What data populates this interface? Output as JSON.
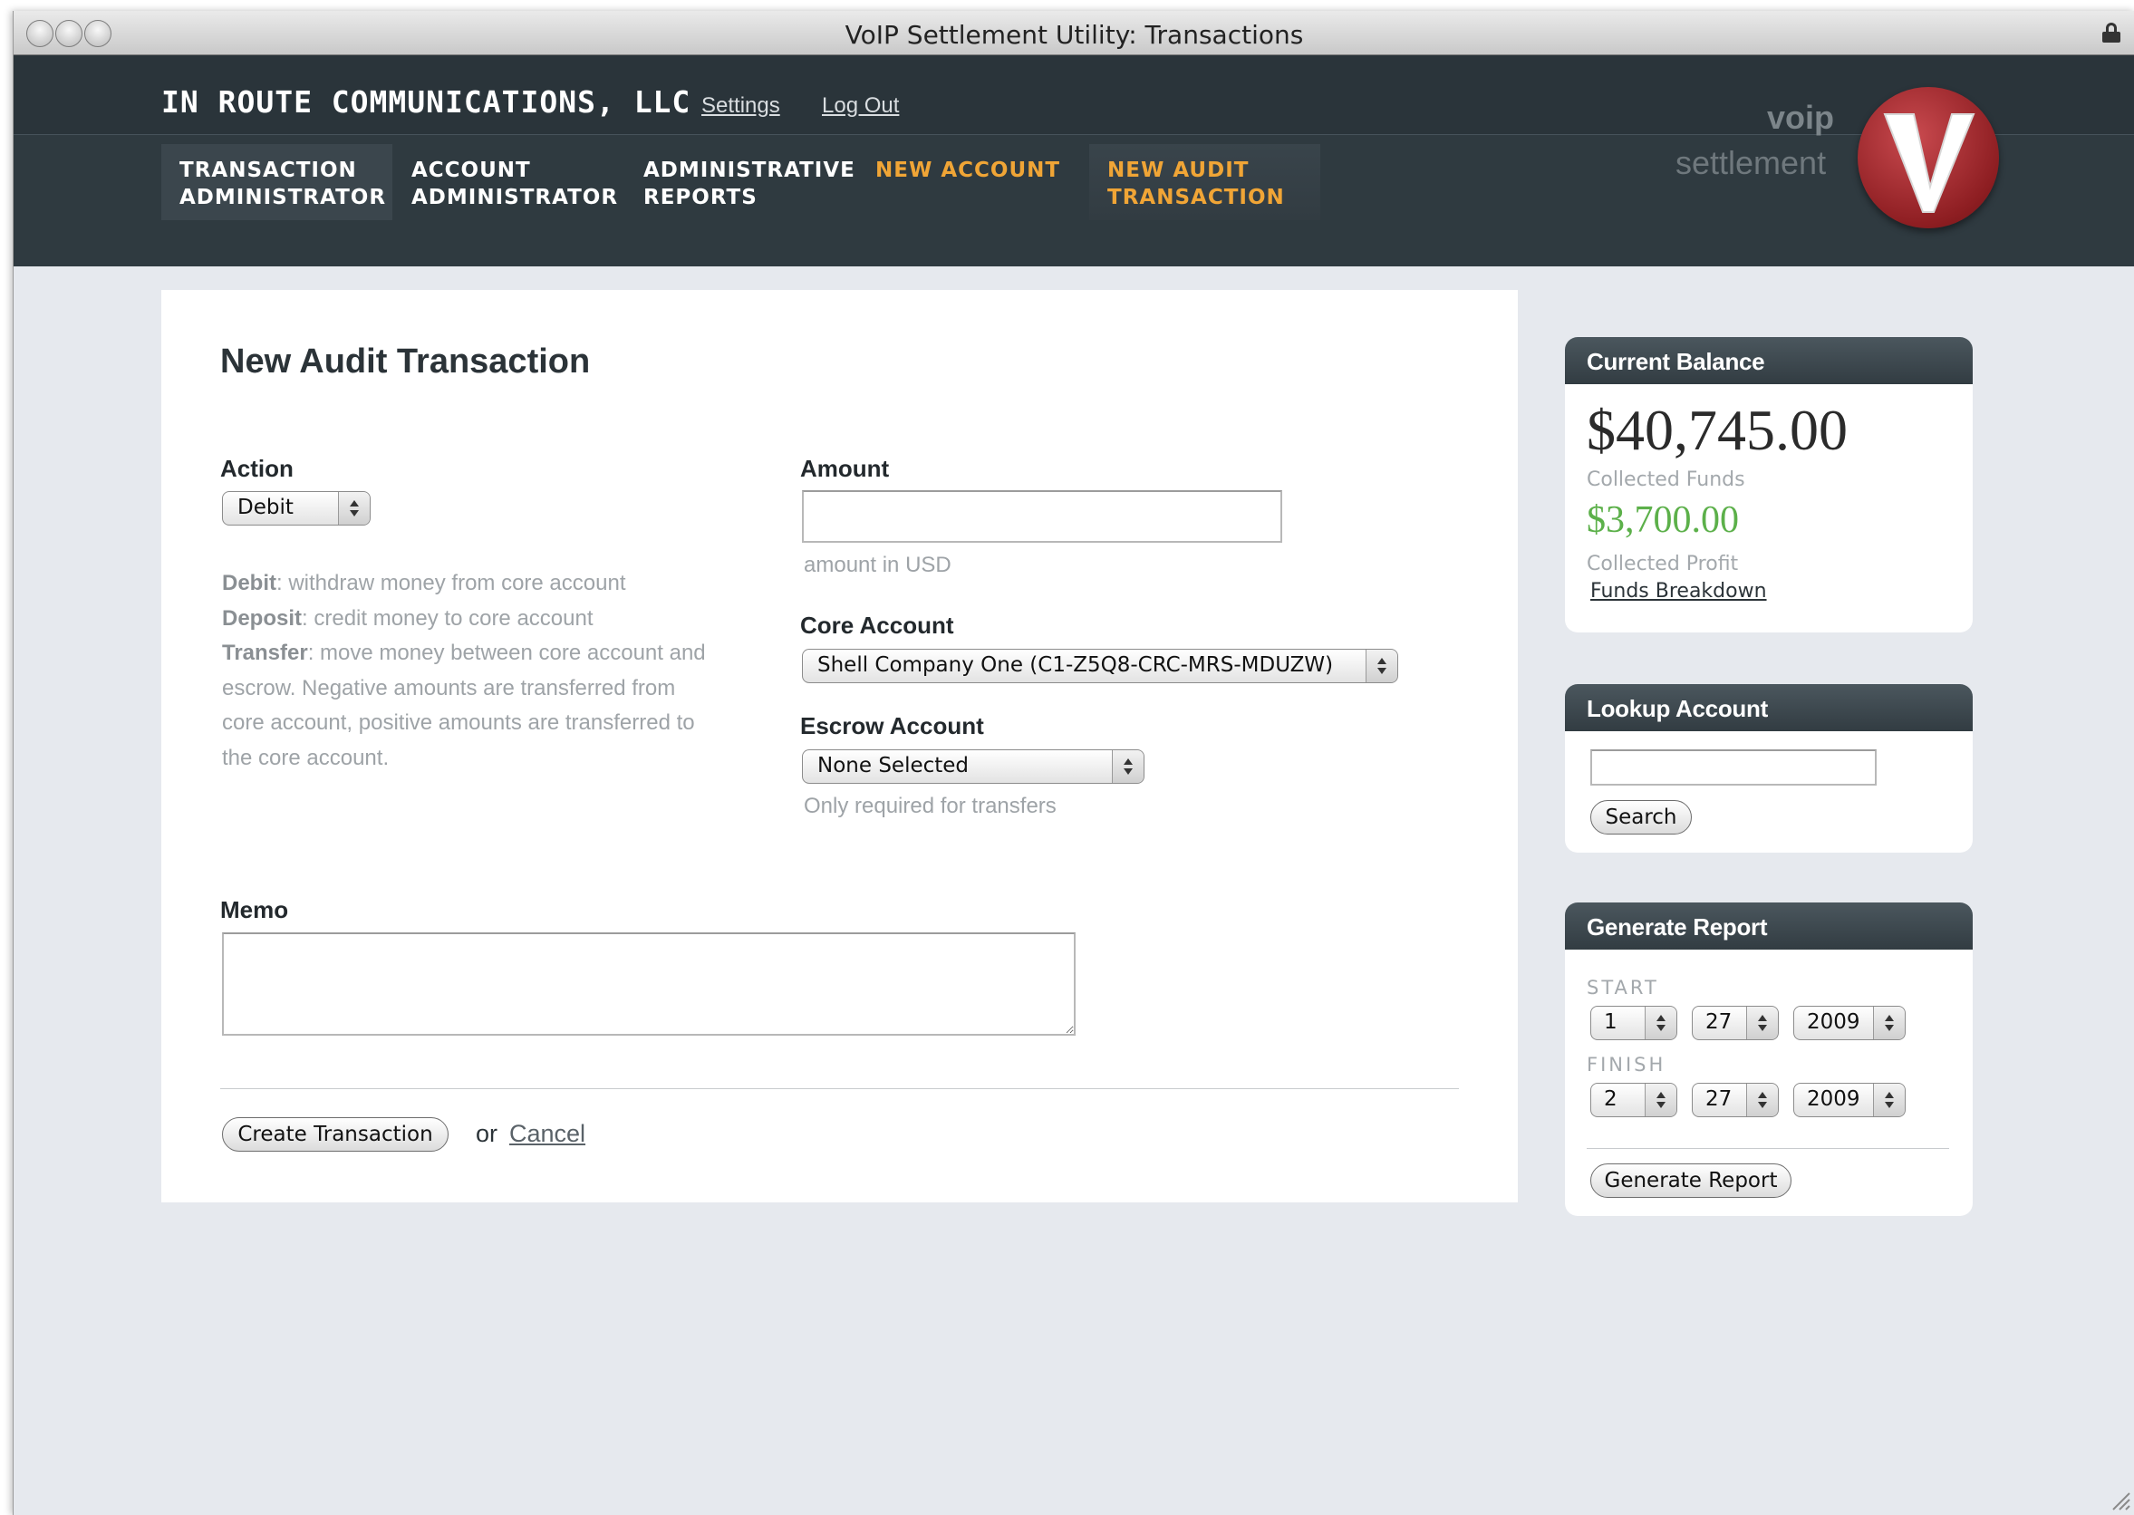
{
  "window": {
    "title": "VoIP Settlement Utility: Transactions"
  },
  "header": {
    "company": "IN ROUTE COMMUNICATIONS, LLC",
    "links": {
      "settings": "Settings",
      "logout": "Log Out"
    },
    "tabs": [
      {
        "line1": "TRANSACTION",
        "line2": "ADMINISTRATOR"
      },
      {
        "line1": "ACCOUNT",
        "line2": "ADMINISTRATOR"
      },
      {
        "line1": "ADMINISTRATIVE",
        "line2": "REPORTS"
      },
      {
        "line1": "NEW ACCOUNT",
        "line2": ""
      },
      {
        "line1": "NEW AUDIT",
        "line2": "TRANSACTION"
      }
    ],
    "logo": {
      "word1": "voip",
      "word2": "settlement"
    },
    "accent_color": "#f0a536"
  },
  "form": {
    "title": "New Audit Transaction",
    "action": {
      "label": "Action",
      "selected": "Debit",
      "help": [
        {
          "term": "Debit",
          "text": ": withdraw money from core account"
        },
        {
          "term": "Deposit",
          "text": ": credit money to core account"
        },
        {
          "term": "Transfer",
          "text": ": move money between core account and"
        }
      ],
      "help_cont": [
        "escrow. Negative amounts are transferred from",
        "core account, positive amounts are transferred to",
        "the core account."
      ]
    },
    "amount": {
      "label": "Amount",
      "value": "",
      "hint": "amount in USD"
    },
    "core_account": {
      "label": "Core Account",
      "selected": "Shell Company One (C1-Z5Q8-CRC-MRS-MDUZW)"
    },
    "escrow_account": {
      "label": "Escrow Account",
      "selected": "None Selected",
      "hint": "Only required for transfers"
    },
    "memo": {
      "label": "Memo",
      "value": ""
    },
    "submit_label": "Create Transaction",
    "or_text": "or",
    "cancel_label": "Cancel"
  },
  "sidebar": {
    "balance": {
      "title": "Current Balance",
      "collected_funds": "$40,745.00",
      "collected_funds_label": "Collected Funds",
      "collected_profit": "$3,700.00",
      "collected_profit_label": "Collected Profit",
      "breakdown_link": "Funds Breakdown",
      "profit_color": "#5cb04a"
    },
    "lookup": {
      "title": "Lookup Account",
      "value": "",
      "button": "Search"
    },
    "report": {
      "title": "Generate Report",
      "start_label": "START",
      "start": {
        "month": "1",
        "day": "27",
        "year": "2009"
      },
      "finish_label": "FINISH",
      "finish": {
        "month": "2",
        "day": "27",
        "year": "2009"
      },
      "button": "Generate Report"
    }
  }
}
